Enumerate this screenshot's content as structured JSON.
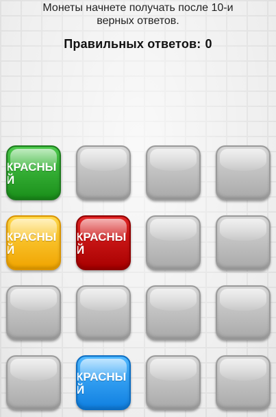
{
  "header": {
    "hint": "Монеты начнете получать после 10-и верных ответов.",
    "score_label": "Правильных ответов:",
    "score_value": "0"
  },
  "grid": {
    "rows": 4,
    "columns": 4,
    "tiles": [
      {
        "color": "green",
        "hex": "#2aa52a",
        "label": "КРАСНЫЙ"
      },
      {
        "color": "gray",
        "hex": "#bdbdbd",
        "label": ""
      },
      {
        "color": "gray",
        "hex": "#bdbdbd",
        "label": ""
      },
      {
        "color": "gray",
        "hex": "#bdbdbd",
        "label": ""
      },
      {
        "color": "yellow",
        "hex": "#f7b900",
        "label": "КРАСНЫЙ"
      },
      {
        "color": "red",
        "hex": "#c40000",
        "label": "КРАСНЫЙ"
      },
      {
        "color": "gray",
        "hex": "#bdbdbd",
        "label": ""
      },
      {
        "color": "gray",
        "hex": "#bdbdbd",
        "label": ""
      },
      {
        "color": "gray",
        "hex": "#bdbdbd",
        "label": ""
      },
      {
        "color": "gray",
        "hex": "#bdbdbd",
        "label": ""
      },
      {
        "color": "gray",
        "hex": "#bdbdbd",
        "label": ""
      },
      {
        "color": "gray",
        "hex": "#bdbdbd",
        "label": ""
      },
      {
        "color": "gray",
        "hex": "#bdbdbd",
        "label": ""
      },
      {
        "color": "blue",
        "hex": "#1e90f0",
        "label": "КРАСНЫЙ"
      },
      {
        "color": "gray",
        "hex": "#bdbdbd",
        "label": ""
      },
      {
        "color": "gray",
        "hex": "#bdbdbd",
        "label": ""
      }
    ]
  }
}
